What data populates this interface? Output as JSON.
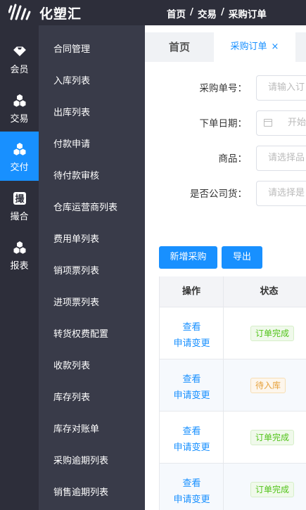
{
  "header": {
    "brand": "化塑汇",
    "breadcrumb": [
      "首页",
      "交易",
      "采购订单"
    ],
    "separator": "/"
  },
  "rail": [
    {
      "label": "会员",
      "icon": "diamond-icon",
      "active": false
    },
    {
      "label": "交易",
      "icon": "cubes-icon",
      "active": false
    },
    {
      "label": "交付",
      "icon": "cubes-icon",
      "active": true
    },
    {
      "label": "撮合",
      "icon": "match-icon",
      "active": false
    },
    {
      "label": "报表",
      "icon": "cubes-icon",
      "active": false
    }
  ],
  "submenu": [
    "合同管理",
    "入库列表",
    "出库列表",
    "付款申请",
    "待付款审核",
    "仓库运营商列表",
    "费用单列表",
    "销项票列表",
    "进项票列表",
    "转货权费配置",
    "收款列表",
    "库存列表",
    "库存对账单",
    "采购逾期列表",
    "销售逾期列表"
  ],
  "tabs": {
    "home": "首页",
    "active": "采购订单",
    "close": "×"
  },
  "form": {
    "order_no": {
      "label": "采购单号：",
      "placeholder": "请输入订"
    },
    "order_date": {
      "label": "下单日期：",
      "placeholder": "开始"
    },
    "product": {
      "label": "商品：",
      "placeholder": "请选择品"
    },
    "company_goods": {
      "label": "是否公司货：",
      "placeholder": "请选择是"
    }
  },
  "actions": {
    "add": "新增采购",
    "export": "导出"
  },
  "table": {
    "headers": [
      "操作",
      "状态"
    ],
    "rows": [
      {
        "view": "查看",
        "change": "申请变更",
        "status": "订单完成",
        "status_color": "green"
      },
      {
        "view": "查看",
        "change": "申请变更",
        "status": "待入库",
        "status_color": "orange"
      },
      {
        "view": "查看",
        "change": "申请变更",
        "status": "订单完成",
        "status_color": "green"
      },
      {
        "view": "查看",
        "change": "申请变更",
        "status": "订单完成",
        "status_color": "green"
      }
    ]
  },
  "colors": {
    "accent": "#1890ff",
    "header_bg": "#2d2e3a",
    "submenu_bg": "#393b49",
    "success": "#52c41a",
    "warning": "#e6a23c"
  }
}
